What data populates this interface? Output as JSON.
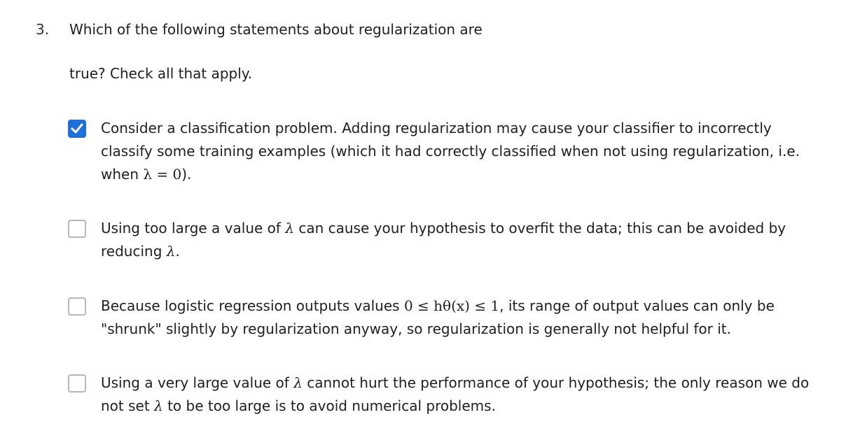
{
  "question": {
    "number": "3.",
    "line1": "Which of the following statements about regularization are",
    "line2": "true? Check all that apply."
  },
  "options": [
    {
      "checked": true,
      "text_before": "Consider a classification problem. Adding regularization may cause your classifier to incorrectly classify some training examples (which it had correctly classified when not using regularization, i.e. when ",
      "math": "λ = 0",
      "text_after": ")."
    },
    {
      "checked": false,
      "text_before": "Using too large a value of ",
      "math": "λ",
      "text_middle": " can cause your hypothesis to overfit the data; this can be avoided by reducing ",
      "math2": "λ",
      "text_after": "."
    },
    {
      "checked": false,
      "text_before": "Because logistic regression outputs values ",
      "math": "0 ≤ hθ(x) ≤ 1",
      "text_after": ", its range of output values can only be \"shrunk\" slightly by regularization anyway, so regularization is generally not helpful for it."
    },
    {
      "checked": false,
      "text_before": "Using a very large value of ",
      "math": "λ",
      "text_middle": " cannot hurt the performance of your hypothesis; the only reason we do not set ",
      "math2": "λ",
      "text_after": " to be too large is to avoid numerical problems."
    }
  ],
  "colors": {
    "checkbox_checked": "#1e6fd9",
    "checkbox_border": "#b7b7b7"
  }
}
